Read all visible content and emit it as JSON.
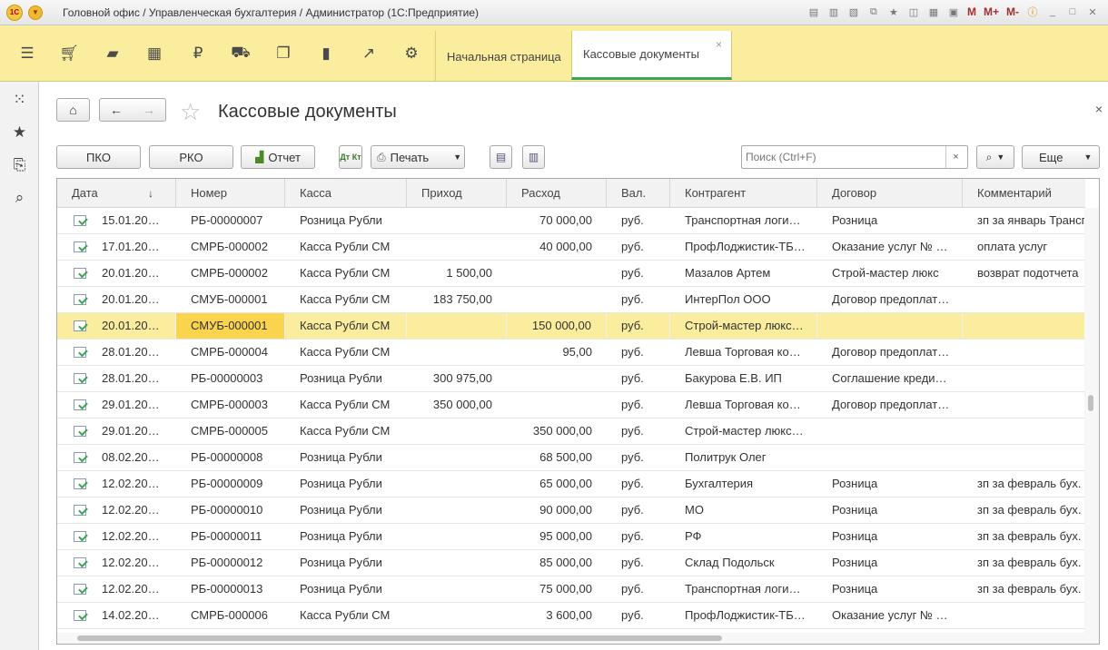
{
  "window": {
    "title": "Головной офис / Управленческая бухгалтерия / Администратор  (1С:Предприятие)",
    "logo_text": "1С",
    "m_labels": [
      "M",
      "M+",
      "M-"
    ]
  },
  "sections": {
    "icons": [
      "menu-icon",
      "cart-icon",
      "bag-icon",
      "grid-icon",
      "ruble-icon",
      "truck-icon",
      "documents-icon",
      "bar-chart-icon",
      "trend-icon",
      "gear-icon"
    ]
  },
  "tabs": [
    {
      "label": "Начальная страница"
    },
    {
      "label": "Кассовые документы",
      "close": "×"
    }
  ],
  "form": {
    "title": "Кассовые документы",
    "close": "×"
  },
  "commands": {
    "pko": "ПКО",
    "rko": "РКО",
    "report": "Отчет",
    "dtkt": "Дт Кт",
    "print": "Печать",
    "more": "Еще"
  },
  "search": {
    "placeholder": "Поиск (Ctrl+F)",
    "clear": "×"
  },
  "table": {
    "columns": [
      "Дата",
      "Номер",
      "Касса",
      "Приход",
      "Расход",
      "Вал.",
      "Контрагент",
      "Договор",
      "Комментарий"
    ],
    "sort_indicator": "↓",
    "selected_row": 4,
    "rows": [
      {
        "date": "15.01.20…",
        "number": "РБ-00000007",
        "kassa": "Розница Рубли",
        "income": "",
        "expense": "70 000,00",
        "cur": "руб.",
        "counterparty": "Транспортная логи…",
        "contract": "Розница",
        "comment": "зп за январь Трансп"
      },
      {
        "date": "17.01.20…",
        "number": "СМРБ-000002",
        "kassa": "Касса Рубли СМ",
        "income": "",
        "expense": "40 000,00",
        "cur": "руб.",
        "counterparty": "ПрофЛоджистик-ТБ…",
        "contract": "Оказание услуг № …",
        "comment": "оплата услуг"
      },
      {
        "date": "20.01.20…",
        "number": "СМРБ-000002",
        "kassa": "Касса Рубли СМ",
        "income": "1 500,00",
        "expense": "",
        "cur": "руб.",
        "counterparty": "Мазалов Артем",
        "contract": "Строй-мастер люкс",
        "comment": "возврат подотчета"
      },
      {
        "date": "20.01.20…",
        "number": "СМУБ-000001",
        "kassa": "Касса Рубли СМ",
        "income": "183 750,00",
        "expense": "",
        "cur": "руб.",
        "counterparty": "ИнтерПол ООО",
        "contract": "Договор предоплат…",
        "comment": ""
      },
      {
        "date": "20.01.20…",
        "number": "СМУБ-000001",
        "kassa": "Касса Рубли СМ",
        "income": "",
        "expense": "150 000,00",
        "cur": "руб.",
        "counterparty": "Строй-мастер люкс…",
        "contract": "",
        "comment": ""
      },
      {
        "date": "28.01.20…",
        "number": "СМРБ-000004",
        "kassa": "Касса Рубли СМ",
        "income": "",
        "expense": "95,00",
        "cur": "руб.",
        "counterparty": "Левша Торговая ко…",
        "contract": "Договор предоплат…",
        "comment": ""
      },
      {
        "date": "28.01.20…",
        "number": "РБ-00000003",
        "kassa": "Розница Рубли",
        "income": "300 975,00",
        "expense": "",
        "cur": "руб.",
        "counterparty": "Бакурова Е.В. ИП",
        "contract": "Соглашение креди…",
        "comment": ""
      },
      {
        "date": "29.01.20…",
        "number": "СМРБ-000003",
        "kassa": "Касса Рубли СМ",
        "income": "350 000,00",
        "expense": "",
        "cur": "руб.",
        "counterparty": "Левша Торговая ко…",
        "contract": "Договор предоплат…",
        "comment": ""
      },
      {
        "date": "29.01.20…",
        "number": "СМРБ-000005",
        "kassa": "Касса Рубли СМ",
        "income": "",
        "expense": "350 000,00",
        "cur": "руб.",
        "counterparty": "Строй-мастер люкс…",
        "contract": "",
        "comment": ""
      },
      {
        "date": "08.02.20…",
        "number": "РБ-00000008",
        "kassa": "Розница Рубли",
        "income": "",
        "expense": "68 500,00",
        "cur": "руб.",
        "counterparty": "Политрук Олег",
        "contract": "",
        "comment": ""
      },
      {
        "date": "12.02.20…",
        "number": "РБ-00000009",
        "kassa": "Розница Рубли",
        "income": "",
        "expense": "65 000,00",
        "cur": "руб.",
        "counterparty": "Бухгалтерия",
        "contract": "Розница",
        "comment": "зп за февраль бух."
      },
      {
        "date": "12.02.20…",
        "number": "РБ-00000010",
        "kassa": "Розница Рубли",
        "income": "",
        "expense": "90 000,00",
        "cur": "руб.",
        "counterparty": "МО",
        "contract": "Розница",
        "comment": "зп за февраль бух."
      },
      {
        "date": "12.02.20…",
        "number": "РБ-00000011",
        "kassa": "Розница Рубли",
        "income": "",
        "expense": "95 000,00",
        "cur": "руб.",
        "counterparty": "РФ",
        "contract": "Розница",
        "comment": "зп за февраль бух."
      },
      {
        "date": "12.02.20…",
        "number": "РБ-00000012",
        "kassa": "Розница Рубли",
        "income": "",
        "expense": "85 000,00",
        "cur": "руб.",
        "counterparty": "Склад Подольск",
        "contract": "Розница",
        "comment": "зп за февраль бух."
      },
      {
        "date": "12.02.20…",
        "number": "РБ-00000013",
        "kassa": "Розница Рубли",
        "income": "",
        "expense": "75 000,00",
        "cur": "руб.",
        "counterparty": "Транспортная логи…",
        "contract": "Розница",
        "comment": "зп за февраль бух."
      },
      {
        "date": "14.02.20…",
        "number": "СМРБ-000006",
        "kassa": "Касса Рубли СМ",
        "income": "",
        "expense": "3 600,00",
        "cur": "руб.",
        "counterparty": "ПрофЛоджистик-ТБ…",
        "contract": "Оказание услуг № …",
        "comment": ""
      }
    ]
  }
}
